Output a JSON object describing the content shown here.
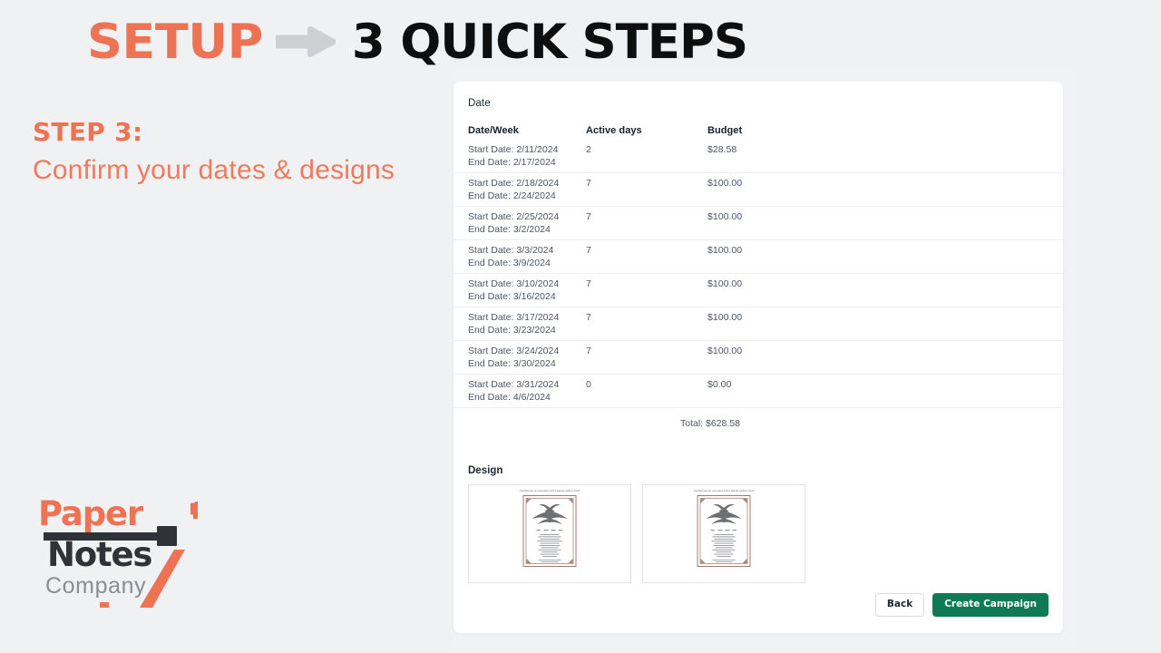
{
  "header": {
    "title_accent": "SETUP",
    "arrow_icon": "arrow-right-icon",
    "title_main": "3 QUICK STEPS",
    "accent_color": "#ee7254",
    "arrow_color": "#cdcfd2",
    "main_color": "#0e0e0e"
  },
  "step": {
    "label": "STEP 3:",
    "description": "Confirm your dates & designs",
    "color": "#ee7254"
  },
  "logo": {
    "line1": "Paper",
    "line2": "Notes",
    "line3": "Company",
    "orange": "#ee7254",
    "dark": "#2f3337",
    "gray": "#8a8d91"
  },
  "card": {
    "date_section_label": "Date",
    "design_section_label": "Design",
    "table": {
      "columns": [
        "Date/Week",
        "Active days",
        "Budget"
      ],
      "rows": [
        {
          "start": "Start Date: 2/11/2024",
          "end": "End Date: 2/17/2024",
          "active_days": "2",
          "budget": "$28.58"
        },
        {
          "start": "Start Date: 2/18/2024",
          "end": "End Date: 2/24/2024",
          "active_days": "7",
          "budget": "$100.00"
        },
        {
          "start": "Start Date: 2/25/2024",
          "end": "End Date: 3/2/2024",
          "active_days": "7",
          "budget": "$100.00"
        },
        {
          "start": "Start Date: 3/3/2024",
          "end": "End Date: 3/9/2024",
          "active_days": "7",
          "budget": "$100.00"
        },
        {
          "start": "Start Date: 3/10/2024",
          "end": "End Date: 3/16/2024",
          "active_days": "7",
          "budget": "$100.00"
        },
        {
          "start": "Start Date: 3/17/2024",
          "end": "End Date: 3/23/2024",
          "active_days": "7",
          "budget": "$100.00"
        },
        {
          "start": "Start Date: 3/24/2024",
          "end": "End Date: 3/30/2024",
          "active_days": "7",
          "budget": "$100.00"
        },
        {
          "start": "Start Date: 3/31/2024",
          "end": "End Date: 4/6/2024",
          "active_days": "0",
          "budget": "$0.00"
        }
      ],
      "total": "Total: $628.58"
    },
    "designs": [
      {
        "caption": "Trial Rhonda's art screenshot submit Sample GetPins 9x100",
        "alt": "eagle-crest-poster-thumbnail"
      },
      {
        "caption": "Trial Rhonda's art screenshot submit Sample GetPins 9x100",
        "alt": "eagle-crest-poster-thumbnail"
      }
    ],
    "footer": {
      "back_label": "Back",
      "create_label": "Create Campaign",
      "create_color": "#0e7a56"
    }
  }
}
